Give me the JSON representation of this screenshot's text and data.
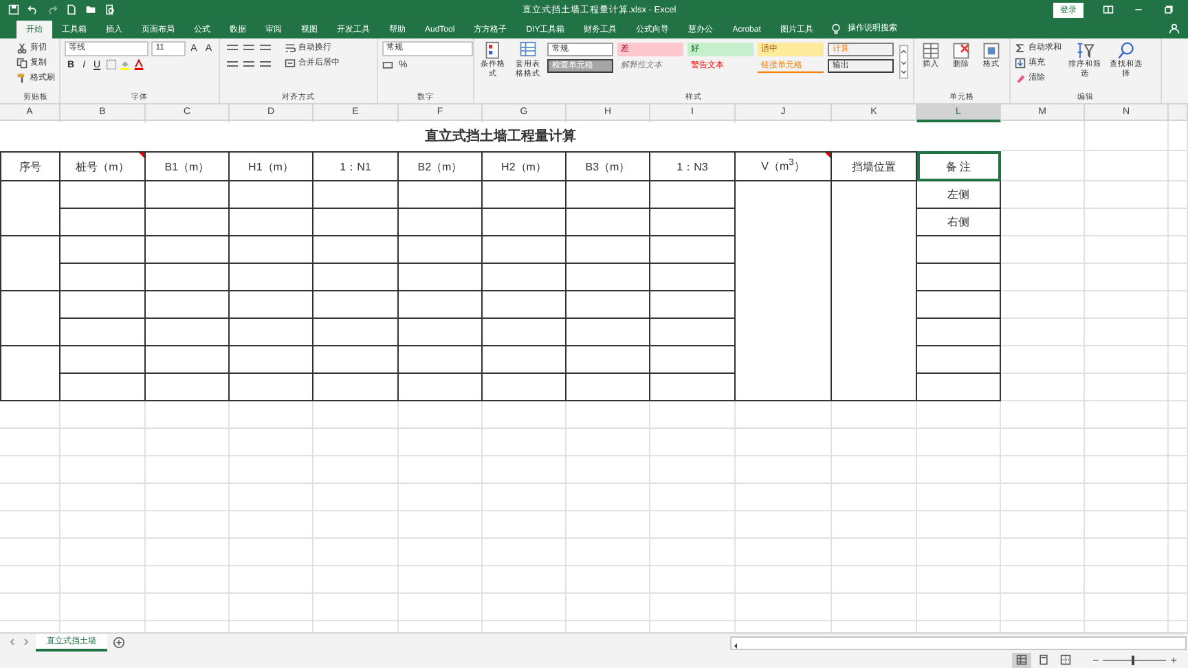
{
  "title_bar": {
    "title": "直立式挡土墙工程量计算.xlsx  -  Excel",
    "sign_in": "登录"
  },
  "ribbon_tabs": [
    {
      "label": "开始",
      "selected": true
    },
    {
      "label": "工具箱",
      "selected": false
    },
    {
      "label": "插入",
      "selected": false
    },
    {
      "label": "页面布局",
      "selected": false
    },
    {
      "label": "公式",
      "selected": false
    },
    {
      "label": "数据",
      "selected": false
    },
    {
      "label": "审阅",
      "selected": false
    },
    {
      "label": "视图",
      "selected": false
    },
    {
      "label": "开发工具",
      "selected": false
    },
    {
      "label": "帮助",
      "selected": false
    },
    {
      "label": "AudTool",
      "selected": false
    },
    {
      "label": "方方格子",
      "selected": false
    },
    {
      "label": "DIY工具箱",
      "selected": false
    },
    {
      "label": "财务工具",
      "selected": false
    },
    {
      "label": "公式向导",
      "selected": false
    },
    {
      "label": "慧办公",
      "selected": false
    },
    {
      "label": "Acrobat",
      "selected": false
    },
    {
      "label": "图片工具",
      "selected": false
    }
  ],
  "tell_me": "操作说明搜索",
  "ribbon": {
    "clipboard": {
      "label": "剪贴板",
      "cut": "剪切",
      "copy": "复制",
      "painter": "格式刷"
    },
    "font": {
      "label": "字体",
      "font_name": "等线",
      "font_size": "11",
      "grow": "A",
      "shrink": "A",
      "bold": "B",
      "italic": "I",
      "underline": "U"
    },
    "alignment": {
      "label": "对齐方式",
      "wrap": "自动换行",
      "merge": "合并后居中"
    },
    "number": {
      "label": "数字",
      "format": "常规",
      "percent": "%"
    },
    "styles": {
      "label": "样式",
      "conditional": "条件格式",
      "table_format": "套用表格格式",
      "cell_styles": [
        {
          "label": "常规",
          "kind": "normal"
        },
        {
          "label": "差",
          "kind": "bad"
        },
        {
          "label": "好",
          "kind": "good"
        },
        {
          "label": "适中",
          "kind": "neutral"
        },
        {
          "label": "计算",
          "kind": "calc"
        },
        {
          "label": "检查单元格",
          "kind": "check"
        },
        {
          "label": "解释性文本",
          "kind": "explanatory"
        },
        {
          "label": "警告文本",
          "kind": "warning"
        },
        {
          "label": "链接单元格",
          "kind": "linked"
        },
        {
          "label": "输出",
          "kind": "output"
        }
      ]
    },
    "cells": {
      "label": "单元格",
      "insert": "插入",
      "delete": "删除",
      "format": "格式"
    },
    "editing": {
      "label": "编辑",
      "autosum": "自动求和",
      "fill": "填充",
      "clear": "清除",
      "sort": "排序和筛选",
      "find": "查找和选择"
    }
  },
  "sheet": {
    "columns": [
      {
        "label": "A",
        "selected": false
      },
      {
        "label": "B",
        "selected": false
      },
      {
        "label": "C",
        "selected": false
      },
      {
        "label": "D",
        "selected": false
      },
      {
        "label": "E",
        "selected": false
      },
      {
        "label": "F",
        "selected": false
      },
      {
        "label": "G",
        "selected": false
      },
      {
        "label": "H",
        "selected": false
      },
      {
        "label": "I",
        "selected": false
      },
      {
        "label": "J",
        "selected": false
      },
      {
        "label": "K",
        "selected": false
      },
      {
        "label": "L",
        "selected": true
      },
      {
        "label": "M",
        "selected": false
      },
      {
        "label": "N",
        "selected": false
      }
    ],
    "title": "直立式挡土墙工程量计算",
    "headers": [
      {
        "label": "序号",
        "comment": false,
        "selected": false
      },
      {
        "label": "桩号（m）",
        "comment": true,
        "selected": false
      },
      {
        "label": "B1（m）",
        "comment": false,
        "selected": false
      },
      {
        "label": "H1（m）",
        "comment": false,
        "selected": false
      },
      {
        "label": "1：N1",
        "comment": false,
        "selected": false
      },
      {
        "label": "B2（m）",
        "comment": false,
        "selected": false
      },
      {
        "label": "H2（m）",
        "comment": false,
        "selected": false
      },
      {
        "label": "B3（m）",
        "comment": false,
        "selected": false
      },
      {
        "label": "1：N3",
        "comment": false,
        "selected": false
      },
      {
        "label": "V（m$^{3}$）",
        "comment": true,
        "selected": false
      },
      {
        "label": "挡墙位置",
        "comment": false,
        "selected": false
      },
      {
        "label": "备 注",
        "comment": false,
        "selected": true
      }
    ],
    "remarks": [
      "左侧",
      "右侧"
    ]
  },
  "sheet_tabs": [
    {
      "label": "直立式挡土墙",
      "selected": true
    }
  ],
  "status_bar": {
    "views": [
      {
        "kind": "normal",
        "selected": true
      },
      {
        "kind": "page_layout",
        "selected": false
      },
      {
        "kind": "page_break",
        "selected": false
      }
    ],
    "zoom_minus": "−",
    "zoom_plus": "+",
    "zoom": {
      "level": 0.45
    }
  }
}
